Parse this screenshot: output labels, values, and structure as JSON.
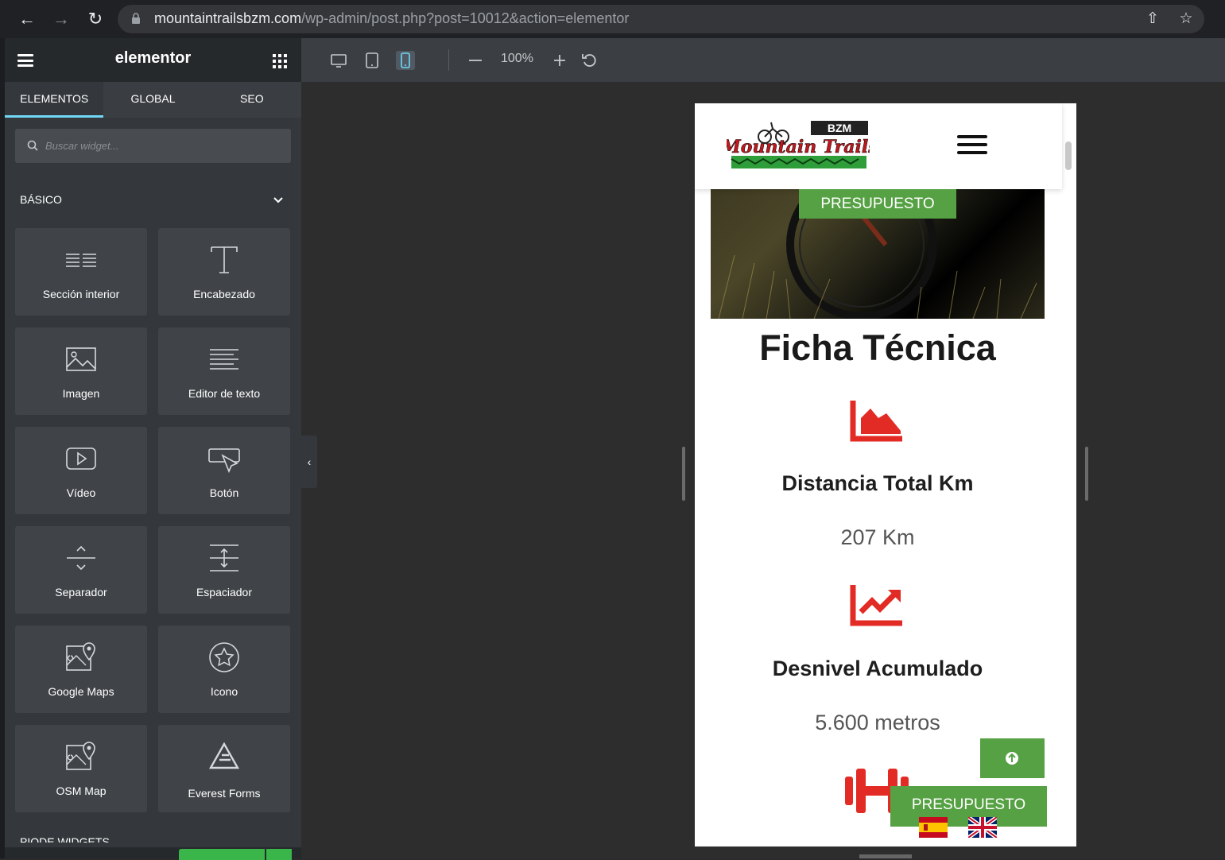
{
  "browser": {
    "url_host": "mountaintrailsbzm.com",
    "url_path": "/wp-admin/post.php?post=10012&action=elementor"
  },
  "panel": {
    "logo": "elementor",
    "tabs": [
      {
        "label": "ELEMENTOS",
        "active": true
      },
      {
        "label": "GLOBAL",
        "active": false
      },
      {
        "label": "SEO",
        "active": false
      }
    ],
    "search_placeholder": "Buscar widget...",
    "category": "BÁSICO",
    "category_next": "PIODE WIDGETS",
    "widgets": [
      {
        "label": "Sección interior",
        "icon": "inner-section-icon"
      },
      {
        "label": "Encabezado",
        "icon": "heading-icon"
      },
      {
        "label": "Imagen",
        "icon": "image-icon"
      },
      {
        "label": "Editor de texto",
        "icon": "text-editor-icon"
      },
      {
        "label": "Vídeo",
        "icon": "video-icon"
      },
      {
        "label": "Botón",
        "icon": "button-icon"
      },
      {
        "label": "Separador",
        "icon": "divider-icon"
      },
      {
        "label": "Espaciador",
        "icon": "spacer-icon"
      },
      {
        "label": "Google Maps",
        "icon": "map-icon"
      },
      {
        "label": "Icono",
        "icon": "star-icon"
      },
      {
        "label": "OSM Map",
        "icon": "map-icon"
      },
      {
        "label": "Everest Forms",
        "icon": "everest-forms-icon"
      }
    ]
  },
  "toolbar": {
    "zoom": "100%",
    "active_device": "mobile"
  },
  "preview": {
    "hero_button": "PRESUPUESTO",
    "section_title": "Ficha Técnica",
    "stats": [
      {
        "title": "Distancia Total Km",
        "value": "207 Km",
        "icon": "area-chart-icon"
      },
      {
        "title": "Desnivel Acumulado",
        "value": "5.600 metros",
        "icon": "line-chart-icon"
      }
    ],
    "floating_button": "PRESUPUESTO",
    "colors": {
      "accent_red": "#e32b25",
      "accent_green": "#56a143",
      "elementor_blue": "#71d7f7"
    }
  }
}
